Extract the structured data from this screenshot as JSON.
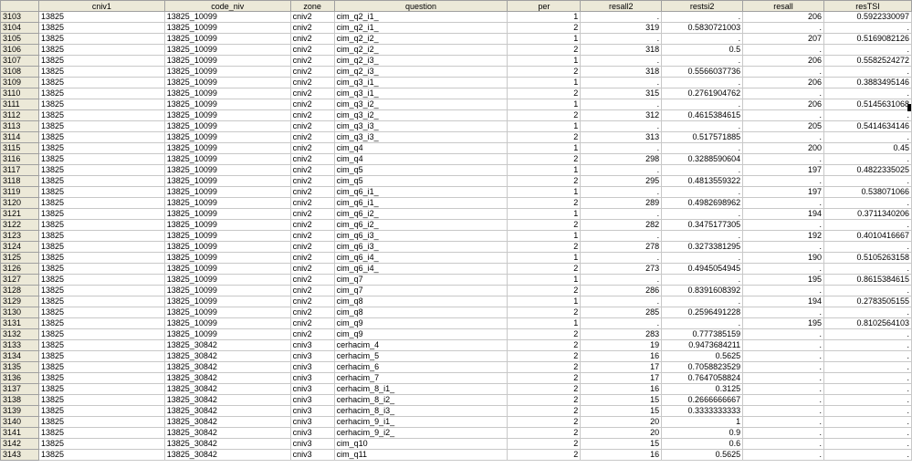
{
  "columns": [
    "",
    "cniv1",
    "code_niv",
    "zone",
    "question",
    "per",
    "resall2",
    "restsi2",
    "resall",
    "resTSI"
  ],
  "rows": [
    [
      "3103",
      "13825",
      "13825_10099",
      "cniv2",
      "cim_q2_i1_",
      "1",
      ".",
      ".",
      "206",
      "0.5922330097"
    ],
    [
      "3104",
      "13825",
      "13825_10099",
      "cniv2",
      "cim_q2_i1_",
      "2",
      "319",
      "0.5830721003",
      ".",
      "."
    ],
    [
      "3105",
      "13825",
      "13825_10099",
      "cniv2",
      "cim_q2_i2_",
      "1",
      ".",
      ".",
      "207",
      "0.5169082126"
    ],
    [
      "3106",
      "13825",
      "13825_10099",
      "cniv2",
      "cim_q2_i2_",
      "2",
      "318",
      "0.5",
      ".",
      "."
    ],
    [
      "3107",
      "13825",
      "13825_10099",
      "cniv2",
      "cim_q2_i3_",
      "1",
      ".",
      ".",
      "206",
      "0.5582524272"
    ],
    [
      "3108",
      "13825",
      "13825_10099",
      "cniv2",
      "cim_q2_i3_",
      "2",
      "318",
      "0.5566037736",
      ".",
      "."
    ],
    [
      "3109",
      "13825",
      "13825_10099",
      "cniv2",
      "cim_q3_i1_",
      "1",
      ".",
      ".",
      "206",
      "0.3883495146"
    ],
    [
      "3110",
      "13825",
      "13825_10099",
      "cniv2",
      "cim_q3_i1_",
      "2",
      "315",
      "0.2761904762",
      ".",
      "."
    ],
    [
      "3111",
      "13825",
      "13825_10099",
      "cniv2",
      "cim_q3_i2_",
      "1",
      ".",
      ".",
      "206",
      "0.5145631068"
    ],
    [
      "3112",
      "13825",
      "13825_10099",
      "cniv2",
      "cim_q3_i2_",
      "2",
      "312",
      "0.4615384615",
      ".",
      "."
    ],
    [
      "3113",
      "13825",
      "13825_10099",
      "cniv2",
      "cim_q3_i3_",
      "1",
      ".",
      ".",
      "205",
      "0.5414634146"
    ],
    [
      "3114",
      "13825",
      "13825_10099",
      "cniv2",
      "cim_q3_i3_",
      "2",
      "313",
      "0.517571885",
      ".",
      "."
    ],
    [
      "3115",
      "13825",
      "13825_10099",
      "cniv2",
      "cim_q4",
      "1",
      ".",
      ".",
      "200",
      "0.45"
    ],
    [
      "3116",
      "13825",
      "13825_10099",
      "cniv2",
      "cim_q4",
      "2",
      "298",
      "0.3288590604",
      ".",
      "."
    ],
    [
      "3117",
      "13825",
      "13825_10099",
      "cniv2",
      "cim_q5",
      "1",
      ".",
      ".",
      "197",
      "0.4822335025"
    ],
    [
      "3118",
      "13825",
      "13825_10099",
      "cniv2",
      "cim_q5",
      "2",
      "295",
      "0.4813559322",
      ".",
      "."
    ],
    [
      "3119",
      "13825",
      "13825_10099",
      "cniv2",
      "cim_q6_i1_",
      "1",
      ".",
      ".",
      "197",
      "0.538071066"
    ],
    [
      "3120",
      "13825",
      "13825_10099",
      "cniv2",
      "cim_q6_i1_",
      "2",
      "289",
      "0.4982698962",
      ".",
      "."
    ],
    [
      "3121",
      "13825",
      "13825_10099",
      "cniv2",
      "cim_q6_i2_",
      "1",
      ".",
      ".",
      "194",
      "0.3711340206"
    ],
    [
      "3122",
      "13825",
      "13825_10099",
      "cniv2",
      "cim_q6_i2_",
      "2",
      "282",
      "0.3475177305",
      ".",
      "."
    ],
    [
      "3123",
      "13825",
      "13825_10099",
      "cniv2",
      "cim_q6_i3_",
      "1",
      ".",
      ".",
      "192",
      "0.4010416667"
    ],
    [
      "3124",
      "13825",
      "13825_10099",
      "cniv2",
      "cim_q6_i3_",
      "2",
      "278",
      "0.3273381295",
      ".",
      "."
    ],
    [
      "3125",
      "13825",
      "13825_10099",
      "cniv2",
      "cim_q6_i4_",
      "1",
      ".",
      ".",
      "190",
      "0.5105263158"
    ],
    [
      "3126",
      "13825",
      "13825_10099",
      "cniv2",
      "cim_q6_i4_",
      "2",
      "273",
      "0.4945054945",
      ".",
      "."
    ],
    [
      "3127",
      "13825",
      "13825_10099",
      "cniv2",
      "cim_q7",
      "1",
      ".",
      ".",
      "195",
      "0.8615384615"
    ],
    [
      "3128",
      "13825",
      "13825_10099",
      "cniv2",
      "cim_q7",
      "2",
      "286",
      "0.8391608392",
      ".",
      "."
    ],
    [
      "3129",
      "13825",
      "13825_10099",
      "cniv2",
      "cim_q8",
      "1",
      ".",
      ".",
      "194",
      "0.2783505155"
    ],
    [
      "3130",
      "13825",
      "13825_10099",
      "cniv2",
      "cim_q8",
      "2",
      "285",
      "0.2596491228",
      ".",
      "."
    ],
    [
      "3131",
      "13825",
      "13825_10099",
      "cniv2",
      "cim_q9",
      "1",
      ".",
      ".",
      "195",
      "0.8102564103"
    ],
    [
      "3132",
      "13825",
      "13825_10099",
      "cniv2",
      "cim_q9",
      "2",
      "283",
      "0.777385159",
      ".",
      "."
    ],
    [
      "3133",
      "13825",
      "13825_30842",
      "cniv3",
      "cerhacim_4",
      "2",
      "19",
      "0.9473684211",
      ".",
      "."
    ],
    [
      "3134",
      "13825",
      "13825_30842",
      "cniv3",
      "cerhacim_5",
      "2",
      "16",
      "0.5625",
      ".",
      "."
    ],
    [
      "3135",
      "13825",
      "13825_30842",
      "cniv3",
      "cerhacim_6",
      "2",
      "17",
      "0.7058823529",
      ".",
      "."
    ],
    [
      "3136",
      "13825",
      "13825_30842",
      "cniv3",
      "cerhacim_7",
      "2",
      "17",
      "0.7647058824",
      ".",
      "."
    ],
    [
      "3137",
      "13825",
      "13825_30842",
      "cniv3",
      "cerhacim_8_i1_",
      "2",
      "16",
      "0.3125",
      ".",
      "."
    ],
    [
      "3138",
      "13825",
      "13825_30842",
      "cniv3",
      "cerhacim_8_i2_",
      "2",
      "15",
      "0.2666666667",
      ".",
      "."
    ],
    [
      "3139",
      "13825",
      "13825_30842",
      "cniv3",
      "cerhacim_8_i3_",
      "2",
      "15",
      "0.3333333333",
      ".",
      "."
    ],
    [
      "3140",
      "13825",
      "13825_30842",
      "cniv3",
      "cerhacim_9_i1_",
      "2",
      "20",
      "1",
      ".",
      "."
    ],
    [
      "3141",
      "13825",
      "13825_30842",
      "cniv3",
      "cerhacim_9_i2_",
      "2",
      "20",
      "0.9",
      ".",
      "."
    ],
    [
      "3142",
      "13825",
      "13825_30842",
      "cniv3",
      "cim_q10",
      "2",
      "15",
      "0.6",
      ".",
      "."
    ],
    [
      "3143",
      "13825",
      "13825_30842",
      "cniv3",
      "cim_q11",
      "2",
      "16",
      "0.5625",
      ".",
      "."
    ]
  ]
}
